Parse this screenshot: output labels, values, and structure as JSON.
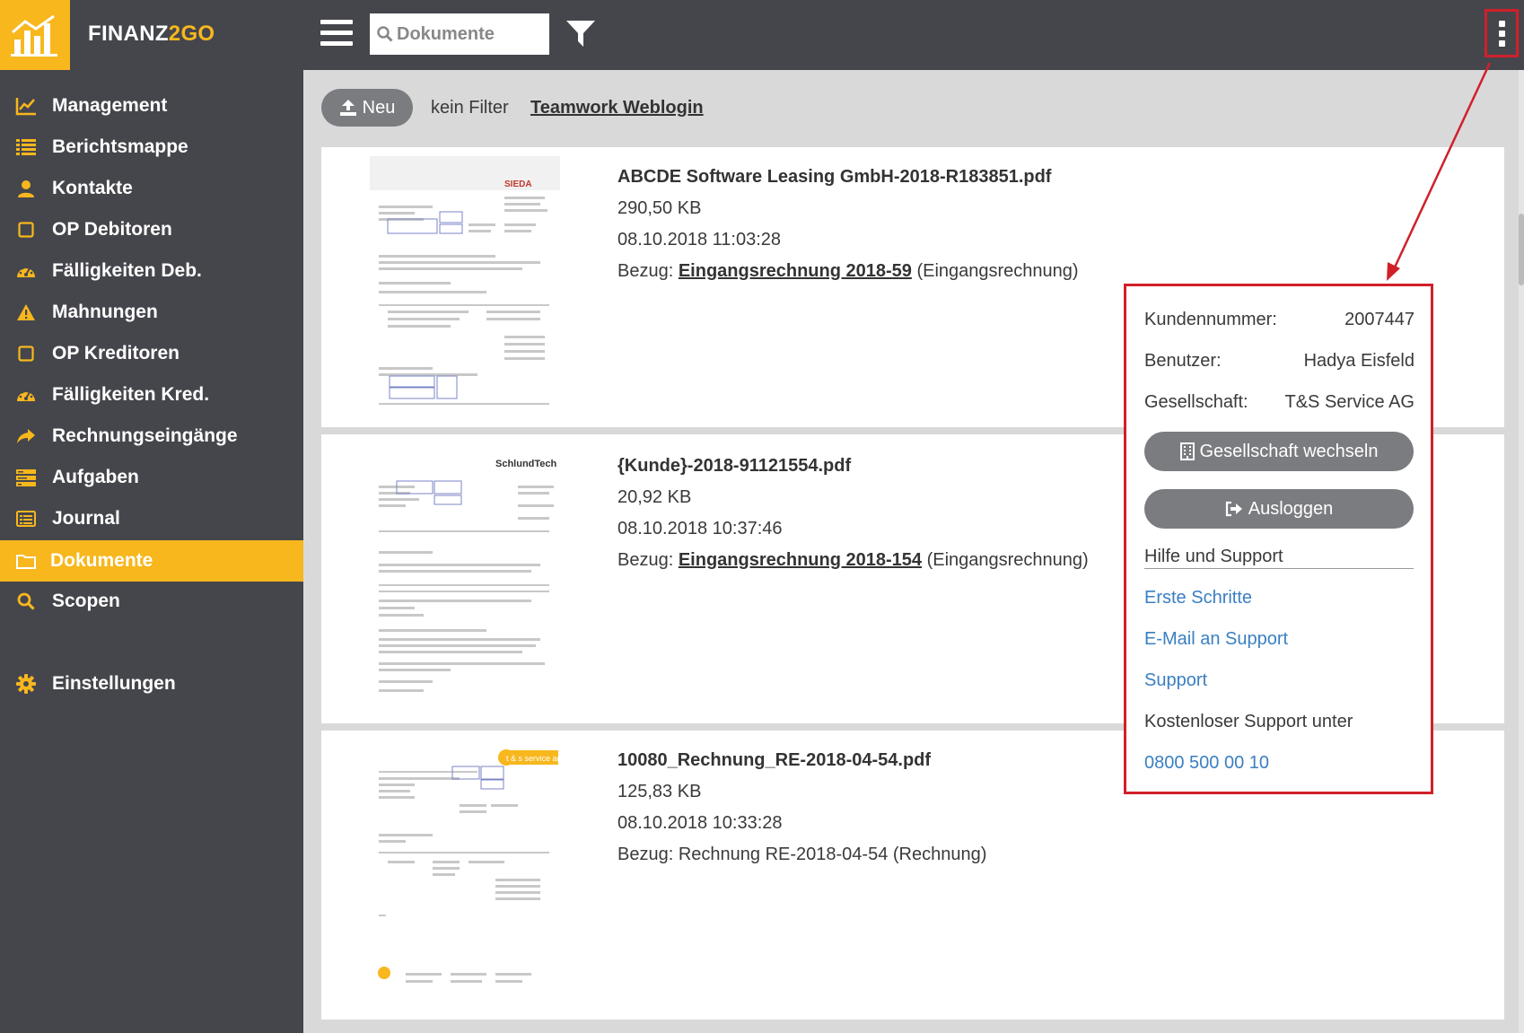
{
  "app": {
    "brand_part1": "FINANZ",
    "brand_part2": "2GO"
  },
  "search": {
    "placeholder": "Dokumente"
  },
  "sidebar": {
    "items": [
      {
        "label": "Management",
        "icon": "chart-line-icon"
      },
      {
        "label": "Berichtsmappe",
        "icon": "list-icon"
      },
      {
        "label": "Kontakte",
        "icon": "user-icon"
      },
      {
        "label": "OP Debitoren",
        "icon": "square-icon"
      },
      {
        "label": "Fälligkeiten Deb.",
        "icon": "dashboard-icon"
      },
      {
        "label": "Mahnungen",
        "icon": "warning-icon"
      },
      {
        "label": "OP Kreditoren",
        "icon": "square-icon"
      },
      {
        "label": "Fälligkeiten Kred.",
        "icon": "dashboard-icon"
      },
      {
        "label": "Rechnungseingänge",
        "icon": "share-arrow-icon"
      },
      {
        "label": "Aufgaben",
        "icon": "tasks-icon"
      },
      {
        "label": "Journal",
        "icon": "journal-icon"
      },
      {
        "label": "Dokumente",
        "icon": "folder-icon",
        "active": true
      },
      {
        "label": "Scopen",
        "icon": "search-icon"
      },
      {
        "label": "Einstellungen",
        "icon": "gear-icon"
      }
    ]
  },
  "toolbar": {
    "new_label": "Neu",
    "filter_label": "kein Filter",
    "team_link": "Teamwork Weblogin"
  },
  "documents": [
    {
      "title": "ABCDE Software Leasing GmbH-2018-R183851.pdf",
      "size": "290,50 KB",
      "date": "08.10.2018 11:03:28",
      "ref_prefix": "Bezug: ",
      "ref_link": "Eingangsrechnung 2018-59",
      "ref_suffix": " (Eingangsrechnung)",
      "thumb_logo": "SIEDA"
    },
    {
      "title": "{Kunde}-2018-91121554.pdf",
      "size": "20,92 KB",
      "date": "08.10.2018 10:37:46",
      "ref_prefix": "Bezug: ",
      "ref_link": "Eingangsrechnung 2018-154",
      "ref_suffix": " (Eingangsrechnung)",
      "thumb_logo": "SchlundTech"
    },
    {
      "title": "10080_Rechnung_RE-2018-04-54.pdf",
      "size": "125,83 KB",
      "date": "08.10.2018 10:33:28",
      "ref_prefix": "Bezug: ",
      "ref_link": "",
      "ref_suffix": "Rechnung RE-2018-04-54 (Rechnung)",
      "thumb_logo": "t & s service ag"
    }
  ],
  "popup": {
    "customer_label": "Kundennummer:",
    "customer_value": "2007447",
    "user_label": "Benutzer:",
    "user_value": "Hadya Eisfeld",
    "company_label": "Gesellschaft:",
    "company_value": "T&S Service AG",
    "switch_button": "Gesellschaft wechseln",
    "logout_button": "Ausloggen",
    "help_heading": "Hilfe und Support",
    "link_first_steps": "Erste Schritte",
    "link_email": "E-Mail an Support",
    "link_support": "Support",
    "free_support_text": "Kostenloser Support unter",
    "phone": "0800 500 00 10"
  },
  "colors": {
    "accent": "#f7b71d",
    "dark": "#45464c",
    "highlight": "#d0202a",
    "link": "#3a7fc1"
  }
}
